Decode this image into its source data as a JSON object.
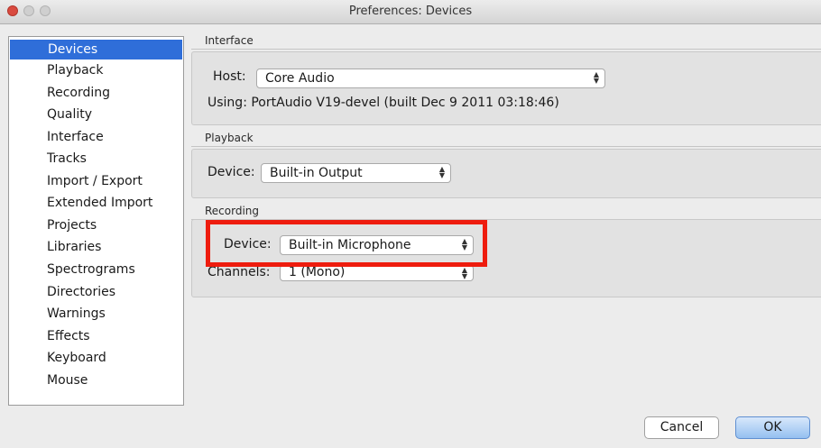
{
  "window": {
    "title": "Preferences: Devices"
  },
  "sidebar": {
    "items": [
      {
        "label": "Devices",
        "selected": true
      },
      {
        "label": "Playback"
      },
      {
        "label": "Recording"
      },
      {
        "label": "Quality"
      },
      {
        "label": "Interface"
      },
      {
        "label": "Tracks"
      },
      {
        "label": "Import / Export"
      },
      {
        "label": "Extended Import"
      },
      {
        "label": "Projects"
      },
      {
        "label": "Libraries"
      },
      {
        "label": "Spectrograms"
      },
      {
        "label": "Directories"
      },
      {
        "label": "Warnings"
      },
      {
        "label": "Effects"
      },
      {
        "label": "Keyboard"
      },
      {
        "label": "Mouse"
      }
    ]
  },
  "interface_section": {
    "heading": "Interface",
    "host_label": "Host:",
    "host_value": "Core Audio",
    "using_text": "Using: PortAudio V19-devel (built Dec  9 2011 03:18:46)"
  },
  "playback_section": {
    "heading": "Playback",
    "device_label": "Device:",
    "device_value": "Built-in Output"
  },
  "recording_section": {
    "heading": "Recording",
    "device_label": "Device:",
    "device_value": "Built-in Microphone",
    "channels_label": "Channels:",
    "channels_value": "1 (Mono)"
  },
  "buttons": {
    "cancel": "Cancel",
    "ok": "OK"
  },
  "colors": {
    "selection": "#2f6ed9",
    "highlight_box": "#ee1c0e",
    "ok_button": "#95c0f0"
  }
}
